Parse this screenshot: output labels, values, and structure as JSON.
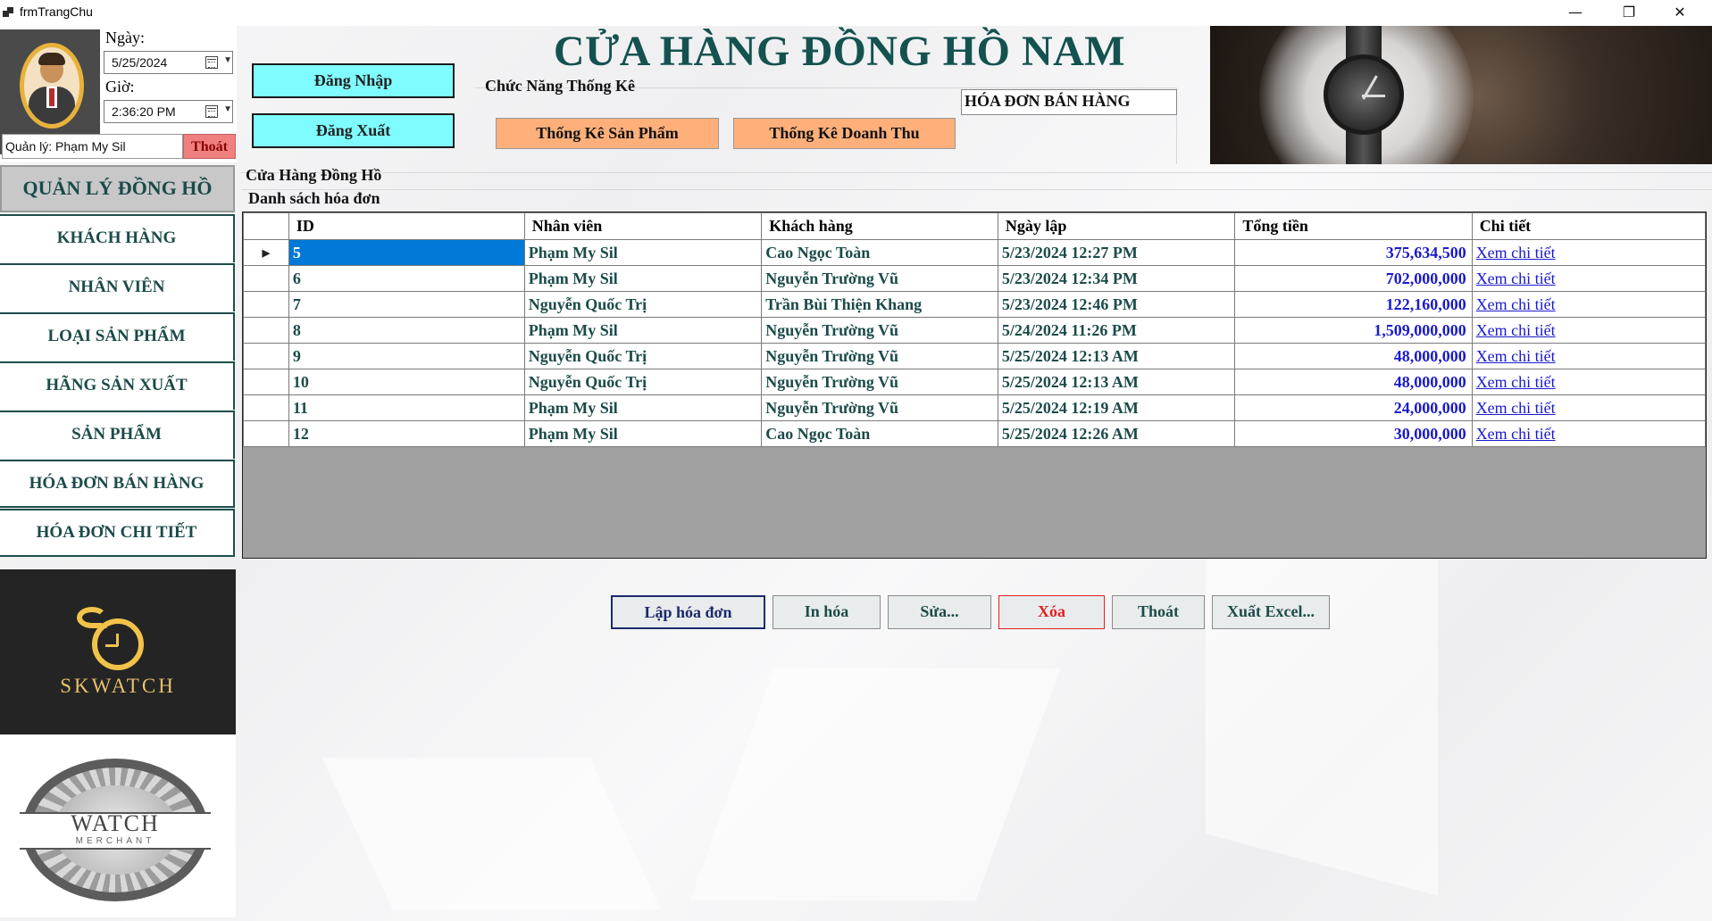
{
  "window": {
    "title": "frmTrangChu",
    "minimize": "—",
    "restore": "❐",
    "close": "✕"
  },
  "user_panel": {
    "date_label": "Ngày:",
    "date_value": "5/25/2024",
    "time_label": "Giờ:",
    "time_value": "2:36:20 PM",
    "manager_text": "Quản lý: Phạm My Sil",
    "logout_label": "Thoát"
  },
  "auth": {
    "login_label": "Đăng Nhập",
    "logout_label": "Đăng Xuất"
  },
  "header": {
    "store_title": "CỬA HÀNG ĐỒNG HỒ NAM",
    "stats_group_label": "Chức Năng Thống Kê",
    "stats_product_label": "Thống Kê Sản Phẩm",
    "stats_revenue_label": "Thống Kê Doanh Thu",
    "current_form": "HÓA ĐƠN BÁN HÀNG"
  },
  "sidebar": {
    "title": "QUẢN LÝ ĐỒNG HỒ",
    "items": [
      {
        "label": "KHÁCH HÀNG"
      },
      {
        "label": "NHÂN VIÊN"
      },
      {
        "label": "LOẠI SẢN PHẨM"
      },
      {
        "label": "HÃNG SẢN XUẤT"
      },
      {
        "label": "SẢN PHẨM"
      },
      {
        "label": "HÓA ĐƠN BÁN HÀNG"
      },
      {
        "label": "HÓA ĐƠN CHI TIẾT"
      }
    ],
    "logo_text": "SKWATCH",
    "merchant_title": "WATCH",
    "merchant_sub": "MERCHANT"
  },
  "main": {
    "group_label": "Cửa Hàng Đồng Hồ",
    "list_label": "Danh sách hóa đơn",
    "columns": [
      "ID",
      "Nhân viên",
      "Khách hàng",
      "Ngày lập",
      "Tổng tiền",
      "Chi tiết"
    ],
    "rows": [
      {
        "id": "5",
        "employee": "Phạm My Sil",
        "customer": "Cao Ngọc Toàn",
        "date": "5/23/2024 12:27 PM",
        "total": "375,634,500",
        "detail": "Xem chi tiết"
      },
      {
        "id": "6",
        "employee": "Phạm My Sil",
        "customer": "Nguyễn Trường Vũ",
        "date": "5/23/2024 12:34 PM",
        "total": "702,000,000",
        "detail": "Xem chi tiết"
      },
      {
        "id": "7",
        "employee": "Nguyễn Quốc Trị",
        "customer": "Trần Bùi Thiện Khang",
        "date": "5/23/2024 12:46 PM",
        "total": "122,160,000",
        "detail": "Xem chi tiết"
      },
      {
        "id": "8",
        "employee": "Phạm My Sil",
        "customer": "Nguyễn Trường Vũ",
        "date": "5/24/2024 11:26 PM",
        "total": "1,509,000,000",
        "detail": "Xem chi tiết"
      },
      {
        "id": "9",
        "employee": "Nguyễn Quốc Trị",
        "customer": "Nguyễn Trường Vũ",
        "date": "5/25/2024 12:13 AM",
        "total": "48,000,000",
        "detail": "Xem chi tiết"
      },
      {
        "id": "10",
        "employee": "Nguyễn Quốc Trị",
        "customer": "Nguyễn Trường Vũ",
        "date": "5/25/2024 12:13 AM",
        "total": "48,000,000",
        "detail": "Xem chi tiết"
      },
      {
        "id": "11",
        "employee": "Phạm My Sil",
        "customer": "Nguyễn Trường Vũ",
        "date": "5/25/2024 12:19 AM",
        "total": "24,000,000",
        "detail": "Xem chi tiết"
      },
      {
        "id": "12",
        "employee": "Phạm My Sil",
        "customer": "Cao Ngọc Toàn",
        "date": "5/25/2024 12:26 AM",
        "total": "30,000,000",
        "detail": "Xem chi tiết"
      }
    ],
    "selected_row": 0,
    "actions": {
      "create": "Lập hóa đơn",
      "print": "In hóa",
      "edit": "Sửa...",
      "delete": "Xóa",
      "exit": "Thoát",
      "export": "Xuất Excel..."
    }
  },
  "colors": {
    "accent_teal": "#1b4b49",
    "cyan_button": "#7ffcff",
    "orange_button": "#ffb07a",
    "selection_blue": "#0078d7",
    "money_blue": "#1a1acc",
    "delete_red": "#e02020",
    "logout_red": "#f08080"
  }
}
